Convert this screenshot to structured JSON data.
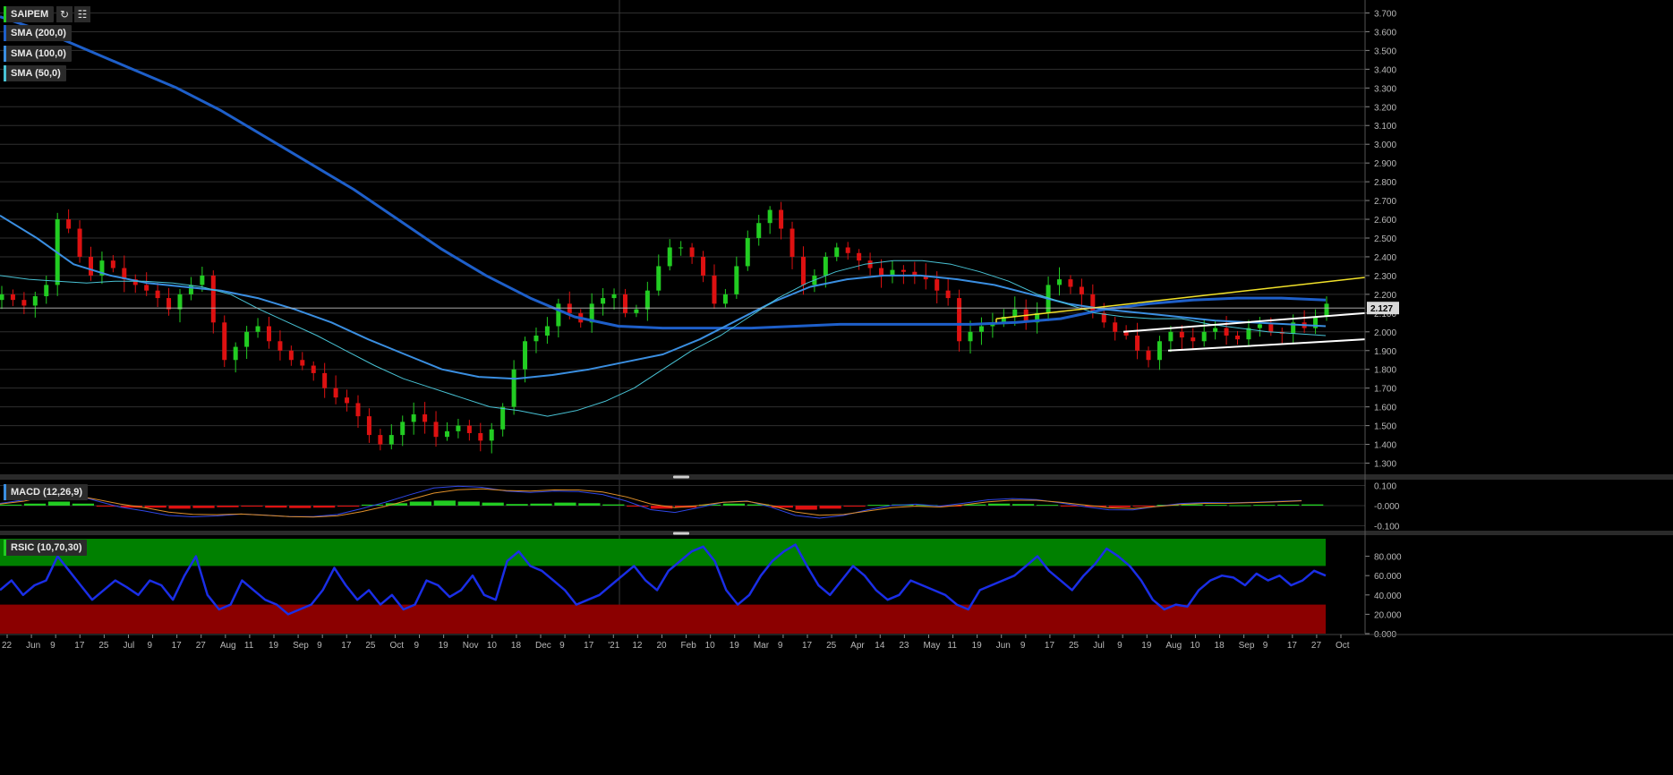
{
  "symbol": "SAIPEM",
  "indicators": {
    "sma200": "SMA (200,0)",
    "sma100": "SMA (100,0)",
    "sma50": "SMA (50,0)",
    "macd": "MACD (12,26,9)",
    "rsi": "RSIC (10,70,30)"
  },
  "colors": {
    "background": "#000000",
    "up_candle": "#22cc22",
    "down_candle": "#dd1111",
    "sma200": "#1e5fc9",
    "sma100": "#3a8ee0",
    "sma50": "#48c2d4",
    "trend_yellow": "#f2e22a",
    "channel_white": "#ffffff",
    "rsi_line": "#1a2ee6",
    "rsi_overbought_zone": "#008000",
    "rsi_oversold_zone": "#8b0000",
    "symbol_marker": "#22cc22"
  },
  "chart_data": [
    {
      "type": "candlestick",
      "name": "price",
      "ylim": [
        1.25,
        3.75
      ],
      "y_ticks": [
        "1.300",
        "1.400",
        "1.500",
        "1.600",
        "1.700",
        "1.800",
        "1.900",
        "2.000",
        "2.100",
        "2.200",
        "2.300",
        "2.400",
        "2.500",
        "2.600",
        "2.700",
        "2.800",
        "2.900",
        "3.000",
        "3.100",
        "3.200",
        "3.300",
        "3.400",
        "3.500",
        "3.600",
        "3.700"
      ],
      "last_price": "2.127",
      "x_labels": [
        "22",
        "Jun",
        "9",
        "17",
        "25",
        "Jul",
        "9",
        "17",
        "27",
        "Aug",
        "11",
        "19",
        "Sep",
        "9",
        "17",
        "25",
        "Oct",
        "9",
        "19",
        "Nov",
        "10",
        "18",
        "Dec",
        "9",
        "17",
        "'21",
        "12",
        "20",
        "Feb",
        "10",
        "19",
        "Mar",
        "9",
        "17",
        "25",
        "Apr",
        "14",
        "23",
        "May",
        "11",
        "19",
        "Jun",
        "9",
        "17",
        "25",
        "Jul",
        "9",
        "19",
        "Aug",
        "10",
        "18",
        "Sep",
        "9",
        "17",
        "27",
        "Oct"
      ],
      "close_series": [
        2.2,
        2.17,
        2.14,
        2.19,
        2.25,
        2.6,
        2.55,
        2.4,
        2.3,
        2.38,
        2.34,
        2.28,
        2.25,
        2.22,
        2.18,
        2.12,
        2.2,
        2.25,
        2.3,
        2.05,
        1.85,
        1.92,
        2.0,
        2.03,
        1.95,
        1.9,
        1.85,
        1.82,
        1.78,
        1.7,
        1.65,
        1.62,
        1.55,
        1.45,
        1.4,
        1.45,
        1.52,
        1.56,
        1.52,
        1.44,
        1.47,
        1.5,
        1.46,
        1.42,
        1.48,
        1.6,
        1.8,
        1.95,
        1.98,
        2.03,
        2.15,
        2.1,
        2.05,
        2.15,
        2.18,
        2.2,
        2.1,
        2.12,
        2.22,
        2.35,
        2.45,
        2.45,
        2.4,
        2.3,
        2.15,
        2.2,
        2.35,
        2.5,
        2.58,
        2.65,
        2.55,
        2.4,
        2.25,
        2.3,
        2.4,
        2.45,
        2.42,
        2.38,
        2.34,
        2.3,
        2.33,
        2.32,
        2.3,
        2.28,
        2.22,
        2.18,
        1.95,
        2.0,
        2.03,
        2.05,
        2.08,
        2.12,
        2.05,
        2.1,
        2.25,
        2.28,
        2.24,
        2.2,
        2.1,
        2.05,
        2.0,
        1.98,
        1.9,
        1.85,
        1.95,
        2.0,
        1.97,
        1.95,
        2.0,
        2.02,
        1.98,
        1.96,
        2.02,
        2.04,
        2.0,
        1.99,
        2.05,
        2.02,
        2.08,
        2.15
      ],
      "sma50": [
        2.3,
        2.28,
        2.27,
        2.26,
        2.27,
        2.27,
        2.26,
        2.24,
        2.2,
        2.12,
        2.05,
        1.98,
        1.9,
        1.82,
        1.75,
        1.7,
        1.65,
        1.6,
        1.58,
        1.55,
        1.58,
        1.63,
        1.7,
        1.8,
        1.9,
        1.98,
        2.08,
        2.18,
        2.26,
        2.32,
        2.36,
        2.38,
        2.38,
        2.36,
        2.32,
        2.27,
        2.2,
        2.15,
        2.1,
        2.08,
        2.07,
        2.07,
        2.04,
        2.02,
        2.0,
        1.99,
        1.98
      ],
      "sma100": [
        2.62,
        2.5,
        2.36,
        2.3,
        2.26,
        2.24,
        2.22,
        2.18,
        2.12,
        2.05,
        1.96,
        1.88,
        1.8,
        1.76,
        1.75,
        1.77,
        1.8,
        1.84,
        1.88,
        1.96,
        2.06,
        2.16,
        2.24,
        2.28,
        2.3,
        2.3,
        2.28,
        2.25,
        2.2,
        2.15,
        2.12,
        2.1,
        2.08,
        2.06,
        2.05,
        2.04,
        2.03
      ],
      "sma200": [
        3.68,
        3.6,
        3.5,
        3.4,
        3.3,
        3.18,
        3.04,
        2.9,
        2.76,
        2.6,
        2.44,
        2.3,
        2.18,
        2.08,
        2.03,
        2.02,
        2.02,
        2.02,
        2.03,
        2.04,
        2.04,
        2.04,
        2.04,
        2.05,
        2.07,
        2.12,
        2.15,
        2.17,
        2.18,
        2.18,
        2.17
      ]
    },
    {
      "type": "bar",
      "name": "macd-histogram",
      "ylim": [
        -0.12,
        0.12
      ],
      "y_ticks": [
        "0.100",
        "-0.000",
        "-0.100"
      ],
      "values": [
        0.005,
        0.01,
        0.02,
        0.01,
        -0.005,
        -0.01,
        -0.01,
        -0.015,
        -0.012,
        -0.008,
        -0.005,
        -0.01,
        -0.012,
        -0.01,
        -0.005,
        0.005,
        0.012,
        0.02,
        0.025,
        0.02,
        0.015,
        0.008,
        0.01,
        0.015,
        0.012,
        0.006,
        -0.005,
        -0.015,
        -0.01,
        0.005,
        0.01,
        0.006,
        -0.01,
        -0.02,
        -0.015,
        -0.005,
        0.004,
        0.006,
        0.003,
        -0.003,
        0.006,
        0.01,
        0.008,
        0.004,
        -0.002,
        -0.006,
        -0.008,
        -0.004,
        0.004,
        0.006,
        0.004,
        0.002,
        0.004,
        0.005,
        0.006
      ]
    },
    {
      "type": "line",
      "name": "rsi",
      "ylim": [
        0,
        100
      ],
      "y_ticks": [
        "80.000",
        "60.000",
        "40.000",
        "20.000",
        "0.000"
      ],
      "overbought": 70,
      "oversold": 30,
      "values": [
        45,
        55,
        40,
        50,
        55,
        80,
        65,
        50,
        35,
        45,
        55,
        48,
        40,
        55,
        50,
        35,
        60,
        80,
        40,
        25,
        30,
        55,
        45,
        35,
        30,
        20,
        25,
        30,
        45,
        68,
        50,
        35,
        45,
        30,
        40,
        25,
        30,
        55,
        50,
        38,
        45,
        60,
        40,
        35,
        75,
        85,
        70,
        65,
        55,
        45,
        30,
        35,
        40,
        50,
        60,
        70,
        55,
        45,
        65,
        75,
        85,
        90,
        75,
        45,
        30,
        40,
        60,
        75,
        85,
        92,
        70,
        50,
        40,
        55,
        70,
        60,
        45,
        35,
        40,
        55,
        50,
        45,
        40,
        30,
        25,
        45,
        50,
        55,
        60,
        70,
        80,
        65,
        55,
        45,
        60,
        72,
        88,
        80,
        70,
        55,
        35,
        25,
        30,
        28,
        45,
        55,
        60,
        58,
        50,
        62,
        55,
        60,
        50,
        55,
        65,
        60
      ]
    }
  ]
}
